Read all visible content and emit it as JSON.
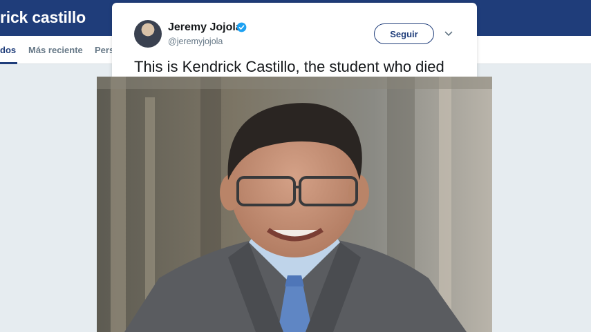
{
  "search": {
    "title": "rick castillo",
    "tabs": [
      {
        "label": "dos",
        "active": true
      },
      {
        "label": "Más reciente",
        "active": false
      },
      {
        "label": "Perso",
        "active": false
      }
    ]
  },
  "tweet": {
    "author_name": "Jeremy Jojola",
    "author_handle": "@jeremyjojola",
    "verified": true,
    "follow_label": "Seguir",
    "text": "This is Kendrick Castillo, the student who died"
  },
  "colors": {
    "header_bg": "#1f3d7a",
    "accent": "#1f3d7a",
    "verified": "#1da1f2",
    "page_bg": "#e6ecf0"
  },
  "icons": {
    "verified": "verified-badge-icon",
    "menu": "chevron-down-icon"
  }
}
